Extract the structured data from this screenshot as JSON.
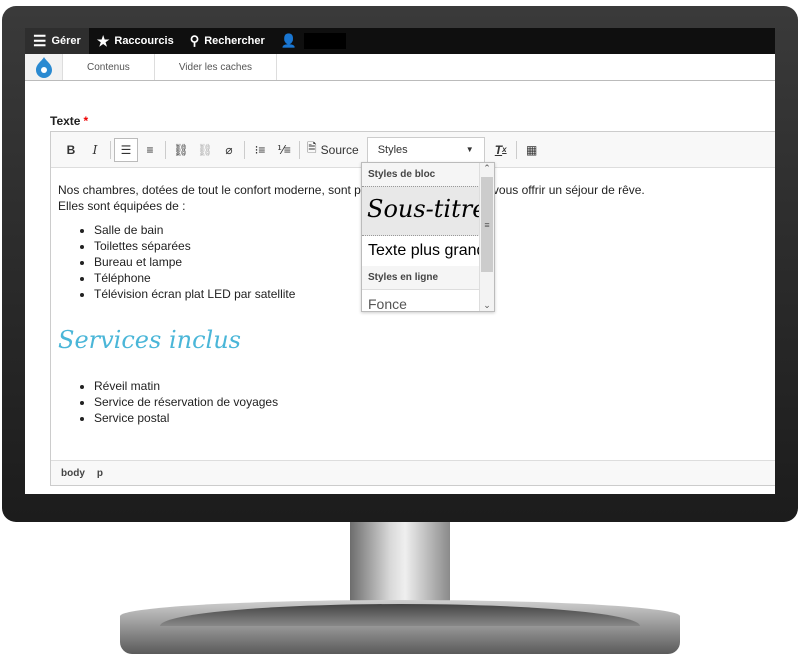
{
  "toolbar": {
    "manage": "Gérer",
    "shortcuts": "Raccourcis",
    "search": "Rechercher"
  },
  "secondary": {
    "links": [
      "Contenus",
      "Vider les caches"
    ]
  },
  "field": {
    "label": "Texte",
    "required": "*"
  },
  "editor": {
    "bold": "B",
    "italic": "I",
    "source": "Source",
    "styles": "Styles",
    "paragraph1": "Nos chambres, dotées de tout le confort moderne, sont prêtes à vous accueillir et vous offrir un séjour de rêve.",
    "paragraph2": "Elles sont équipées de :",
    "list1": [
      "Salle de bain",
      "Toilettes séparées",
      "Bureau et lampe",
      "Téléphone",
      "Télévision écran plat LED par satellite"
    ],
    "heading": "Services inclus",
    "list2": [
      "Réveil matin",
      "Service de réservation de voyages",
      "Service postal"
    ],
    "path": [
      "body",
      "p"
    ]
  },
  "styles_dropdown": {
    "group_block": "Styles de bloc",
    "option_subtitle": "Sous-titre",
    "option_large": "Texte plus grand",
    "group_inline": "Styles en ligne",
    "option_dark": "Fonce"
  },
  "colors": {
    "heading": "#4ab6d8",
    "toolbar_bg": "#0f0f0f"
  }
}
